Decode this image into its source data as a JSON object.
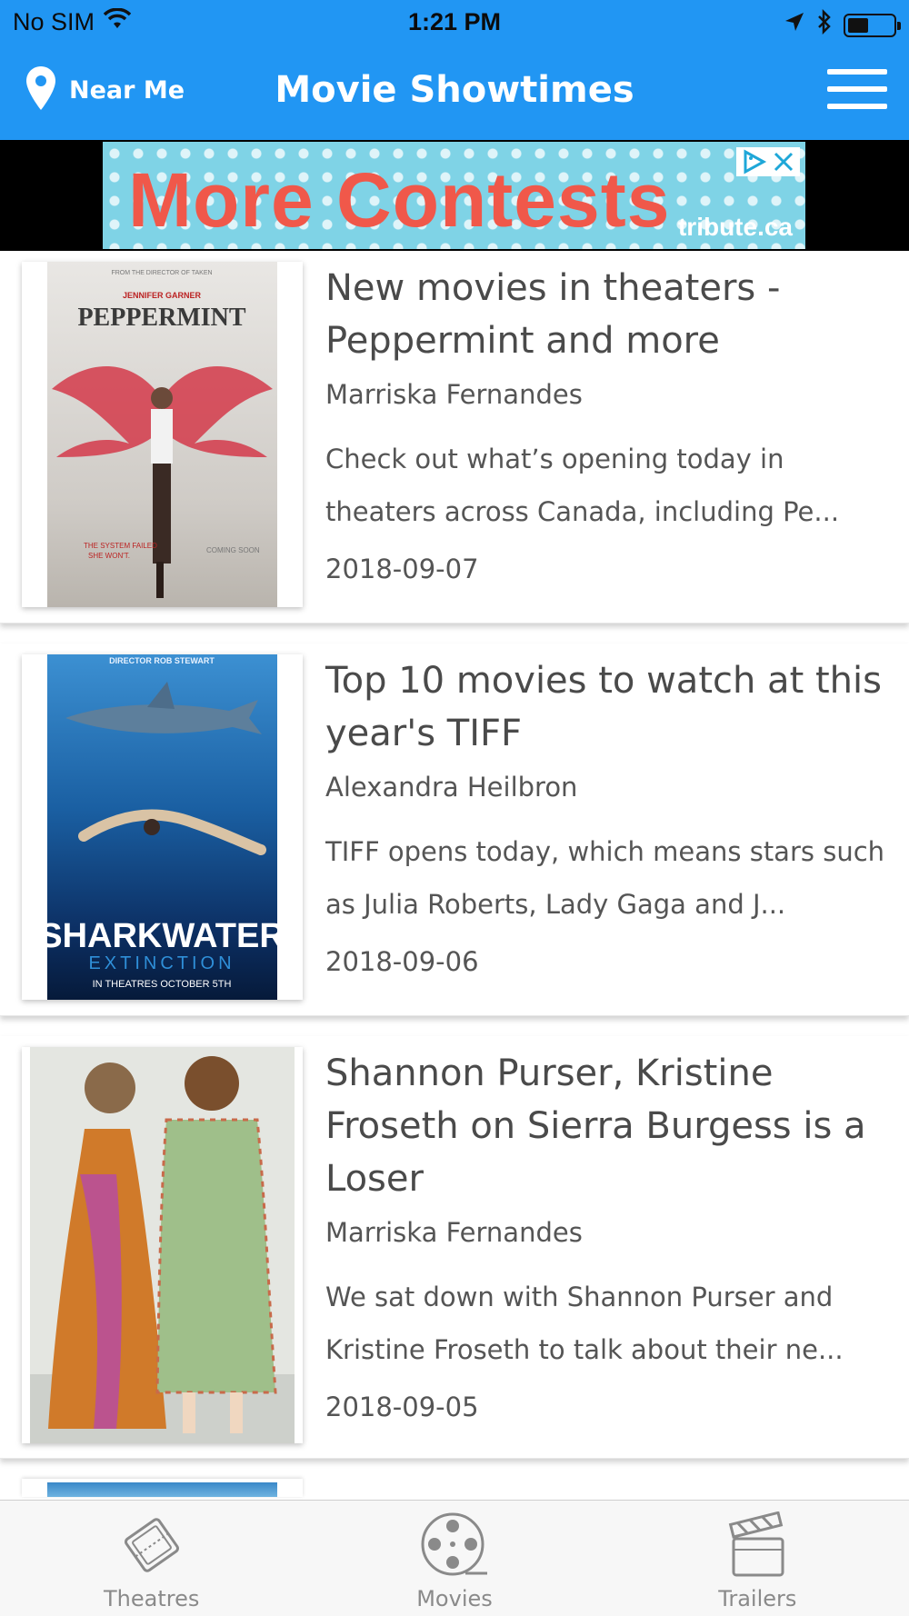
{
  "status_bar": {
    "carrier": "No SIM",
    "time": "1:21 PM"
  },
  "header": {
    "near_me_label": "Near Me",
    "title": "Movie Showtimes",
    "brand_color": "#2196F3"
  },
  "ad": {
    "headline": "More Contests",
    "brand": "tribute.ca"
  },
  "articles": [
    {
      "title": "New movies in theaters - Peppermint and more",
      "author": "Marriska Fernandes",
      "summary": "Check out what’s opening today in theaters across Canada, including Pe...",
      "date": "2018-09-07",
      "poster_title": "PEPPERMINT",
      "poster_top": "JENNIFER GARNER"
    },
    {
      "title": "Top 10 movies to watch at this year's TIFF",
      "author": "Alexandra Heilbron",
      "summary": "TIFF opens today, which means stars such as Julia Roberts, Lady Gaga and J...",
      "date": "2018-09-06",
      "poster_top": "DIRECTOR ROB STEWART",
      "poster_title": "SHARKWATER",
      "poster_subtitle": "EXTINCTION",
      "poster_footer": "IN THEATRES OCTOBER 5TH"
    },
    {
      "title": "Shannon Purser, Kristine Froseth on Sierra Burgess is a Loser",
      "author": "Marriska Fernandes",
      "summary": "We sat down with Shannon Purser and Kristine Froseth to talk about their ne...",
      "date": "2018-09-05"
    }
  ],
  "tabs": [
    {
      "label": "Theatres",
      "icon": "ticket-icon"
    },
    {
      "label": "Movies",
      "icon": "film-reel-icon"
    },
    {
      "label": "Trailers",
      "icon": "clapperboard-icon"
    }
  ]
}
